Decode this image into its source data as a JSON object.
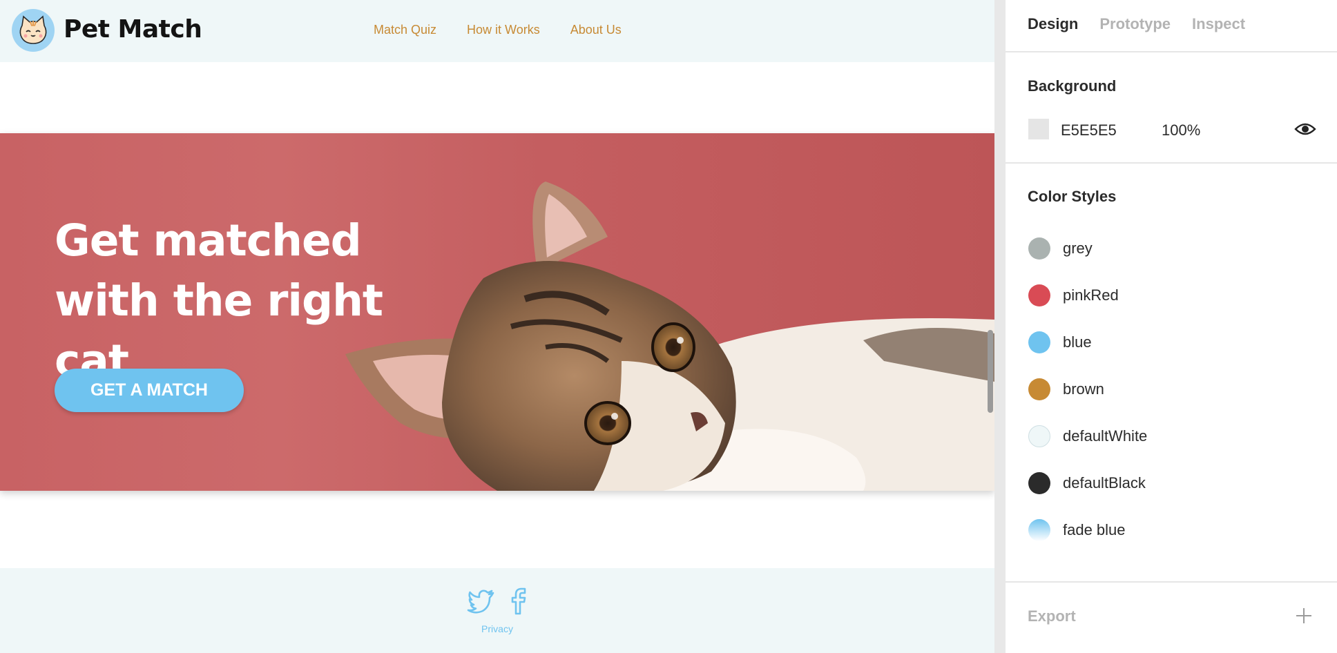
{
  "site": {
    "brand": "Pet Match",
    "nav": [
      "Match Quiz",
      "How it Works",
      "About Us"
    ],
    "hero": {
      "title": "Get matched with the right cat",
      "cta": "GET A MATCH"
    },
    "footer": {
      "privacy": "Privacy",
      "social_icons": [
        "twitter-icon",
        "facebook-icon"
      ]
    }
  },
  "panel": {
    "tabs": [
      "Design",
      "Prototype",
      "Inspect"
    ],
    "active_tab": "Design",
    "background": {
      "title": "Background",
      "hex": "E5E5E5",
      "opacity": "100%"
    },
    "color_styles": {
      "title": "Color Styles",
      "items": [
        {
          "name": "grey",
          "color": "#aab2b0"
        },
        {
          "name": "pinkRed",
          "color": "#d94b55"
        },
        {
          "name": "blue",
          "color": "#6fc3ef"
        },
        {
          "name": "brown",
          "color": "#c78a34"
        },
        {
          "name": "defaultWhite",
          "color": "#eff7f8"
        },
        {
          "name": "defaultBlack",
          "color": "#2b2b2b"
        },
        {
          "name": "fade blue",
          "color": "#6fc3ef"
        }
      ]
    },
    "export": {
      "title": "Export"
    }
  },
  "colors": {
    "accent_blue": "#6fc3ef",
    "nav_brown": "#c78a34",
    "header_bg": "#eff7f8",
    "hero_red": "#c86264"
  }
}
